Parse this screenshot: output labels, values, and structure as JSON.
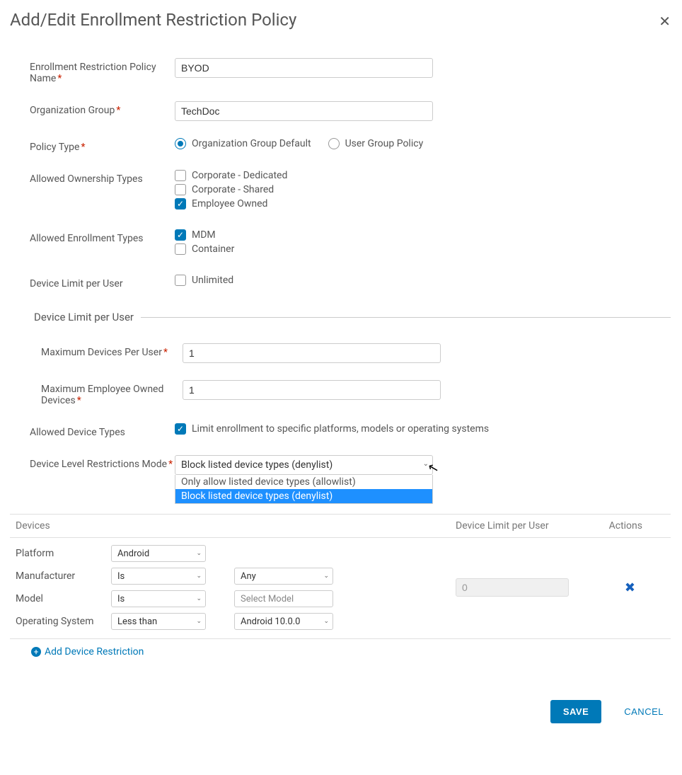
{
  "dialog": {
    "title": "Add/Edit Enrollment Restriction Policy"
  },
  "fields": {
    "policy_name": {
      "label": "Enrollment Restriction Policy Name",
      "value": "BYOD"
    },
    "org_group": {
      "label": "Organization Group",
      "value": "TechDoc"
    },
    "policy_type": {
      "label": "Policy Type",
      "options": [
        "Organization Group Default",
        "User Group Policy"
      ],
      "selected": 0
    },
    "ownership": {
      "label": "Allowed Ownership Types",
      "options": [
        {
          "label": "Corporate - Dedicated",
          "checked": false
        },
        {
          "label": "Corporate - Shared",
          "checked": false
        },
        {
          "label": "Employee Owned",
          "checked": true
        }
      ]
    },
    "enrollment": {
      "label": "Allowed Enrollment Types",
      "options": [
        {
          "label": "MDM",
          "checked": true
        },
        {
          "label": "Container",
          "checked": false
        }
      ]
    },
    "device_limit_flag": {
      "label": "Device Limit per User",
      "option": {
        "label": "Unlimited",
        "checked": false
      }
    }
  },
  "section": {
    "title": "Device Limit per User",
    "max_devices": {
      "label": "Maximum Devices Per User",
      "value": "1"
    },
    "max_employee": {
      "label": "Maximum Employee Owned Devices",
      "value": "1"
    }
  },
  "allowed_device_types": {
    "label": "Allowed Device Types",
    "checkbox": {
      "label": "Limit enrollment to specific platforms, models or operating systems",
      "checked": true
    }
  },
  "restrictions_mode": {
    "label": "Device Level Restrictions Mode",
    "selected": "Block listed device types (denylist)",
    "options": [
      "Only allow listed device types (allowlist)",
      "Block listed device types (denylist)"
    ]
  },
  "devices_grid": {
    "headers": [
      "Devices",
      "Device Limit per User",
      "Actions"
    ],
    "row": {
      "platform_label": "Platform",
      "platform_value": "Android",
      "manufacturer_label": "Manufacturer",
      "manufacturer_op": "Is",
      "manufacturer_value": "Any",
      "model_label": "Model",
      "model_op": "Is",
      "model_value": "Select Model",
      "os_label": "Operating System",
      "os_op": "Less than",
      "os_value": "Android 10.0.0",
      "limit": "0"
    },
    "add_link": "Add Device Restriction"
  },
  "footer": {
    "save": "SAVE",
    "cancel": "CANCEL"
  }
}
